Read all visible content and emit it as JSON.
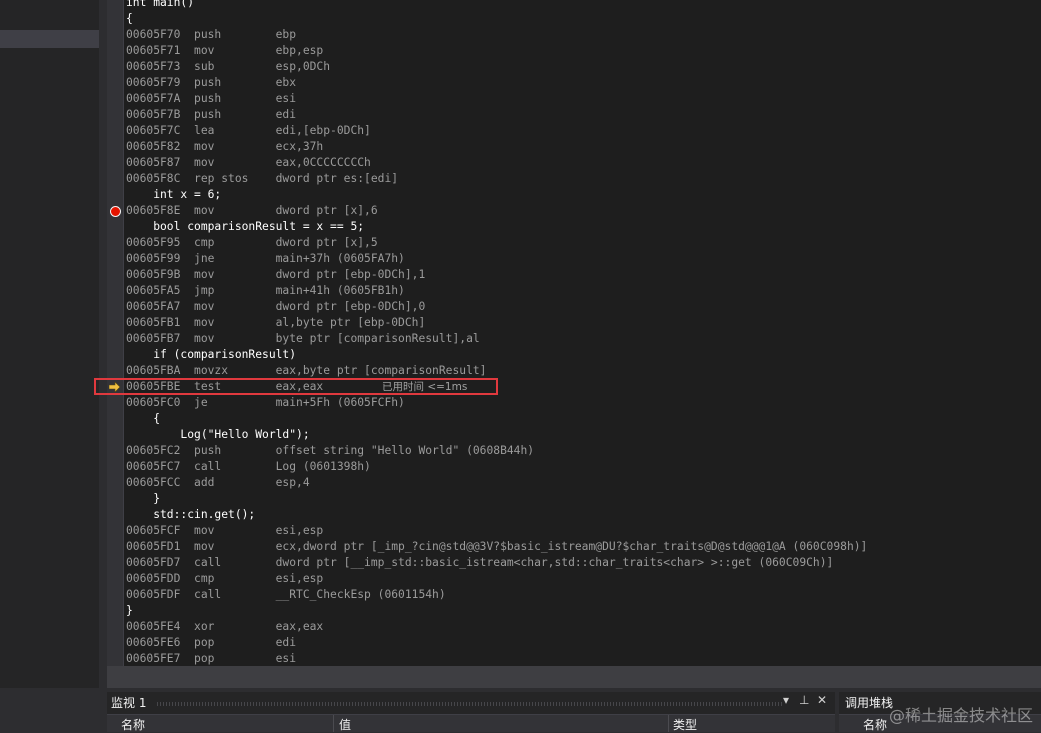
{
  "disassembly": {
    "lines": [
      {
        "kind": "src",
        "text": "int main()"
      },
      {
        "kind": "src",
        "text": "{"
      },
      {
        "kind": "asm",
        "text": "00605F70  push        ebp"
      },
      {
        "kind": "asm",
        "text": "00605F71  mov         ebp,esp"
      },
      {
        "kind": "asm",
        "text": "00605F73  sub         esp,0DCh"
      },
      {
        "kind": "asm",
        "text": "00605F79  push        ebx"
      },
      {
        "kind": "asm",
        "text": "00605F7A  push        esi"
      },
      {
        "kind": "asm",
        "text": "00605F7B  push        edi"
      },
      {
        "kind": "asm",
        "text": "00605F7C  lea         edi,[ebp-0DCh]"
      },
      {
        "kind": "asm",
        "text": "00605F82  mov         ecx,37h"
      },
      {
        "kind": "asm",
        "text": "00605F87  mov         eax,0CCCCCCCCh"
      },
      {
        "kind": "asm",
        "text": "00605F8C  rep stos    dword ptr es:[edi]"
      },
      {
        "kind": "src",
        "text": "    int x = 6;"
      },
      {
        "kind": "asm",
        "text": "00605F8E  mov         dword ptr [x],6",
        "breakpoint": true
      },
      {
        "kind": "src",
        "text": "    bool comparisonResult = x == 5;"
      },
      {
        "kind": "asm",
        "text": "00605F95  cmp         dword ptr [x],5"
      },
      {
        "kind": "asm",
        "text": "00605F99  jne         main+37h (0605FA7h)"
      },
      {
        "kind": "asm",
        "text": "00605F9B  mov         dword ptr [ebp-0DCh],1"
      },
      {
        "kind": "asm",
        "text": "00605FA5  jmp         main+41h (0605FB1h)"
      },
      {
        "kind": "asm",
        "text": "00605FA7  mov         dword ptr [ebp-0DCh],0"
      },
      {
        "kind": "asm",
        "text": "00605FB1  mov         al,byte ptr [ebp-0DCh]"
      },
      {
        "kind": "asm",
        "text": "00605FB7  mov         byte ptr [comparisonResult],al"
      },
      {
        "kind": "src",
        "text": "    if (comparisonResult)"
      },
      {
        "kind": "asm",
        "text": "00605FBA  movzx       eax,byte ptr [comparisonResult]"
      },
      {
        "kind": "asm",
        "text": "00605FBE  test        eax,eax",
        "current": true,
        "perf_tip": "已用时间 <=1ms"
      },
      {
        "kind": "asm",
        "text": "00605FC0  je          main+5Fh (0605FCFh)"
      },
      {
        "kind": "src",
        "text": "    {"
      },
      {
        "kind": "src",
        "text": "        Log(\"Hello World\");"
      },
      {
        "kind": "asm",
        "text": "00605FC2  push        offset string \"Hello World\" (0608B44h)"
      },
      {
        "kind": "asm",
        "text": "00605FC7  call        Log (0601398h)"
      },
      {
        "kind": "asm",
        "text": "00605FCC  add         esp,4"
      },
      {
        "kind": "src",
        "text": "    }"
      },
      {
        "kind": "src",
        "text": "    std::cin.get();"
      },
      {
        "kind": "asm",
        "text": "00605FCF  mov         esi,esp"
      },
      {
        "kind": "asm",
        "text": "00605FD1  mov         ecx,dword ptr [_imp_?cin@std@@3V?$basic_istream@DU?$char_traits@D@std@@@1@A (060C098h)]"
      },
      {
        "kind": "asm",
        "text": "00605FD7  call        dword ptr [__imp_std::basic_istream<char,std::char_traits<char> >::get (060C09Ch)]"
      },
      {
        "kind": "asm",
        "text": "00605FDD  cmp         esi,esp"
      },
      {
        "kind": "asm",
        "text": "00605FDF  call        __RTC_CheckEsp (0601154h)"
      },
      {
        "kind": "src",
        "text": "}"
      },
      {
        "kind": "asm",
        "text": "00605FE4  xor         eax,eax"
      },
      {
        "kind": "asm",
        "text": "00605FE6  pop         edi"
      },
      {
        "kind": "asm",
        "text": "00605FE7  pop         esi"
      }
    ]
  },
  "watch_panel": {
    "title": "监视 1",
    "dropdown_glyph": "▾",
    "pin_glyph": "⊥",
    "close_glyph": "✕",
    "columns": [
      "名称",
      "值",
      "类型"
    ]
  },
  "callstack_panel": {
    "title": "调用堆栈",
    "columns": [
      "名称"
    ]
  },
  "watermark": "@稀土掘金技术社区",
  "colors": {
    "breakpoint": "#e51400",
    "current_line_box": "#e0393e",
    "instruction_pointer": "#f0c040"
  }
}
